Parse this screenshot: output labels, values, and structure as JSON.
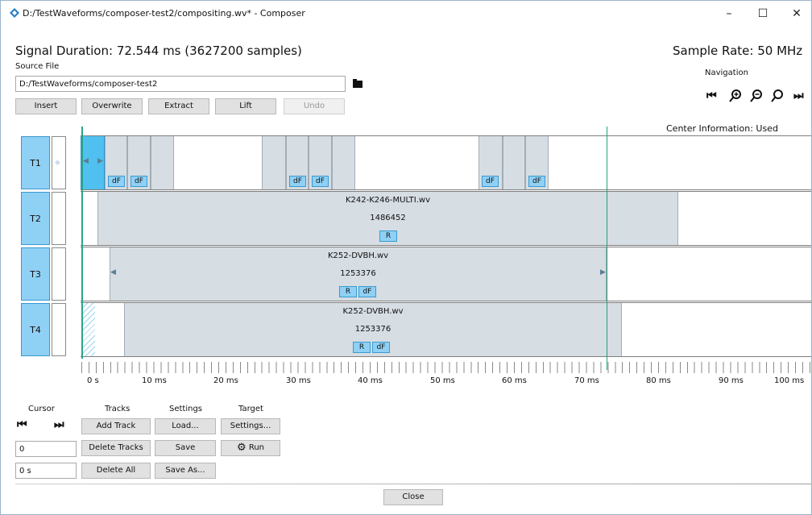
{
  "window": {
    "title": "D:/TestWaveforms/composer-test2/compositing.wv* - Composer",
    "controls": {
      "minimize": "–",
      "maximize": "☐",
      "close": "✕"
    }
  },
  "header": {
    "signal_duration": "Signal Duration: 72.544 ms (3627200 samples)",
    "sample_rate": "Sample Rate: 50 MHz",
    "source_file_label": "Source File",
    "source_file_value": "D:/TestWaveforms/composer-test2",
    "navigation_label": "Navigation"
  },
  "edit_buttons": {
    "insert": "Insert",
    "overwrite": "Overwrite",
    "extract": "Extract",
    "lift": "Lift",
    "undo": "Undo"
  },
  "center_info": "Center Information: Used Samples",
  "tracks": [
    {
      "label": "T1"
    },
    {
      "label": "T2",
      "clip_name": "K242-K246-MULTI.wv",
      "samples": "1486452",
      "tags": [
        "R"
      ]
    },
    {
      "label": "T3",
      "clip_name": "K252-DVBH.wv",
      "samples": "1253376",
      "tags": [
        "R",
        "dF"
      ]
    },
    {
      "label": "T4",
      "clip_name": "K252-DVBH.wv",
      "samples": "1253376",
      "tags": [
        "R",
        "dF"
      ]
    }
  ],
  "t1_tag": "dF",
  "timeline": {
    "tick_labels": [
      "0 s",
      "10 ms",
      "20 ms",
      "30 ms",
      "40 ms",
      "50 ms",
      "60 ms",
      "70 ms",
      "80 ms",
      "90 ms",
      "100 ms"
    ]
  },
  "bottom": {
    "cursor_label": "Cursor",
    "tracks_label": "Tracks",
    "settings_label": "Settings",
    "target_label": "Target",
    "add_track": "Add Track",
    "delete_tracks": "Delete Tracks",
    "delete_all": "Delete All",
    "load": "Load...",
    "save": "Save",
    "save_as": "Save As...",
    "target_settings": "Settings...",
    "run": "Run",
    "cursor_sample": "0",
    "cursor_time": "0 s",
    "close": "Close"
  },
  "colors": {
    "accent": "#8fd0f5",
    "selected_clip": "#4fc0ef",
    "clip_fill": "#d6dde3",
    "cursor_line": "#2aa58a",
    "marker_line": "#23a07a"
  },
  "icons": [
    "app-icon",
    "folder-icon",
    "skip-start-icon",
    "zoom-in-icon",
    "zoom-out-icon",
    "zoom-fit-icon",
    "skip-end-icon",
    "gear-icon"
  ]
}
